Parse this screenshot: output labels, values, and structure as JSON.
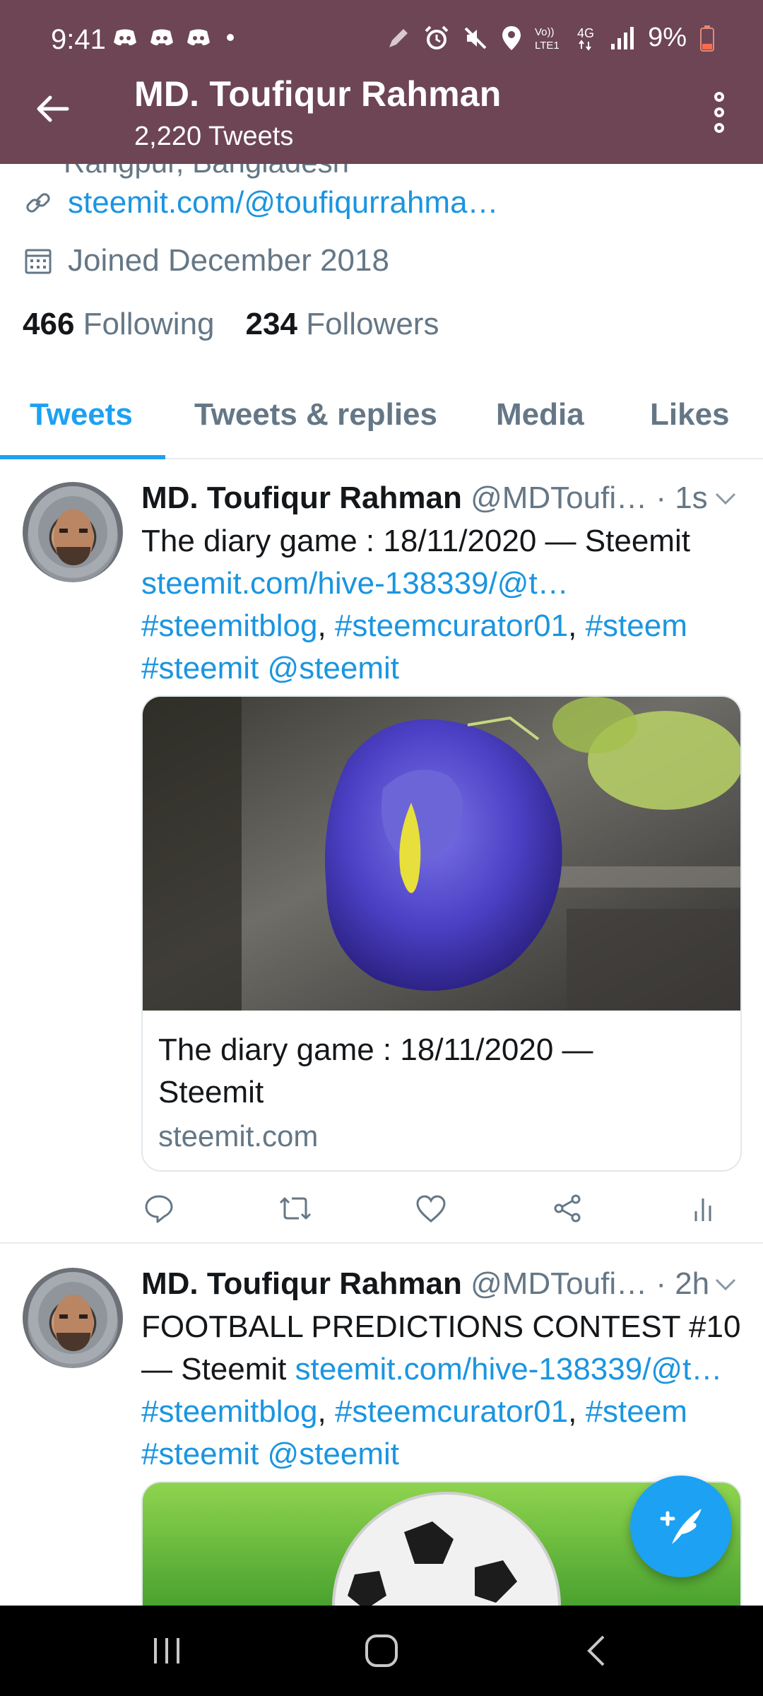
{
  "status_bar": {
    "time": "9:41",
    "battery": "9%",
    "network": "4G",
    "volte": "Vo)) LTE1",
    "icons": [
      "discord-icon",
      "discord-icon",
      "discord-icon",
      "dot-icon",
      "pen-icon",
      "alarm-icon",
      "mute-icon",
      "location-icon",
      "signal-icon",
      "battery-icon"
    ]
  },
  "header": {
    "title": "MD. Toufiqur Rahman",
    "subtitle": "2,220 Tweets"
  },
  "profile": {
    "location_cut": "Rangpur, Bangladesh",
    "website": "steemit.com/@toufiqurrahma…",
    "joined": "Joined December 2018",
    "following_count": "466",
    "following_label": "Following",
    "followers_count": "234",
    "followers_label": "Followers"
  },
  "tabs": [
    {
      "label": "Tweets",
      "active": true
    },
    {
      "label": "Tweets & replies",
      "active": false
    },
    {
      "label": "Media",
      "active": false
    },
    {
      "label": "Likes",
      "active": false
    }
  ],
  "tweets": [
    {
      "name": "MD. Toufiqur Rahman",
      "handle": "@MDToufi… · 1s",
      "line1": "The diary game : 18/11/2020 — Steemit",
      "line2": "steemit.com/hive-138339/@t…",
      "tags": [
        "#steemitblog",
        "#steemcurator01",
        "#steem"
      ],
      "line4": [
        "#steemit",
        "@steemit"
      ],
      "card": {
        "title": "The diary game : 18/11/2020 —",
        "title2": "Steemit",
        "domain": "steemit.com"
      }
    },
    {
      "name": "MD. Toufiqur Rahman",
      "handle": "@MDToufi… · 2h",
      "line1": "FOOTBALL PREDICTIONS CONTEST #10",
      "line2_text": "— Steemit ",
      "line2_link": "steemit.com/hive-138339/@t…",
      "tags": [
        "#steemitblog",
        "#steemcurator01",
        "#steem"
      ],
      "line4": [
        "#steemit",
        "@steemit"
      ]
    }
  ],
  "colors": {
    "header_bg": "#6d4554",
    "accent": "#1da1f2",
    "link": "#1b95e0",
    "muted": "#657786"
  }
}
